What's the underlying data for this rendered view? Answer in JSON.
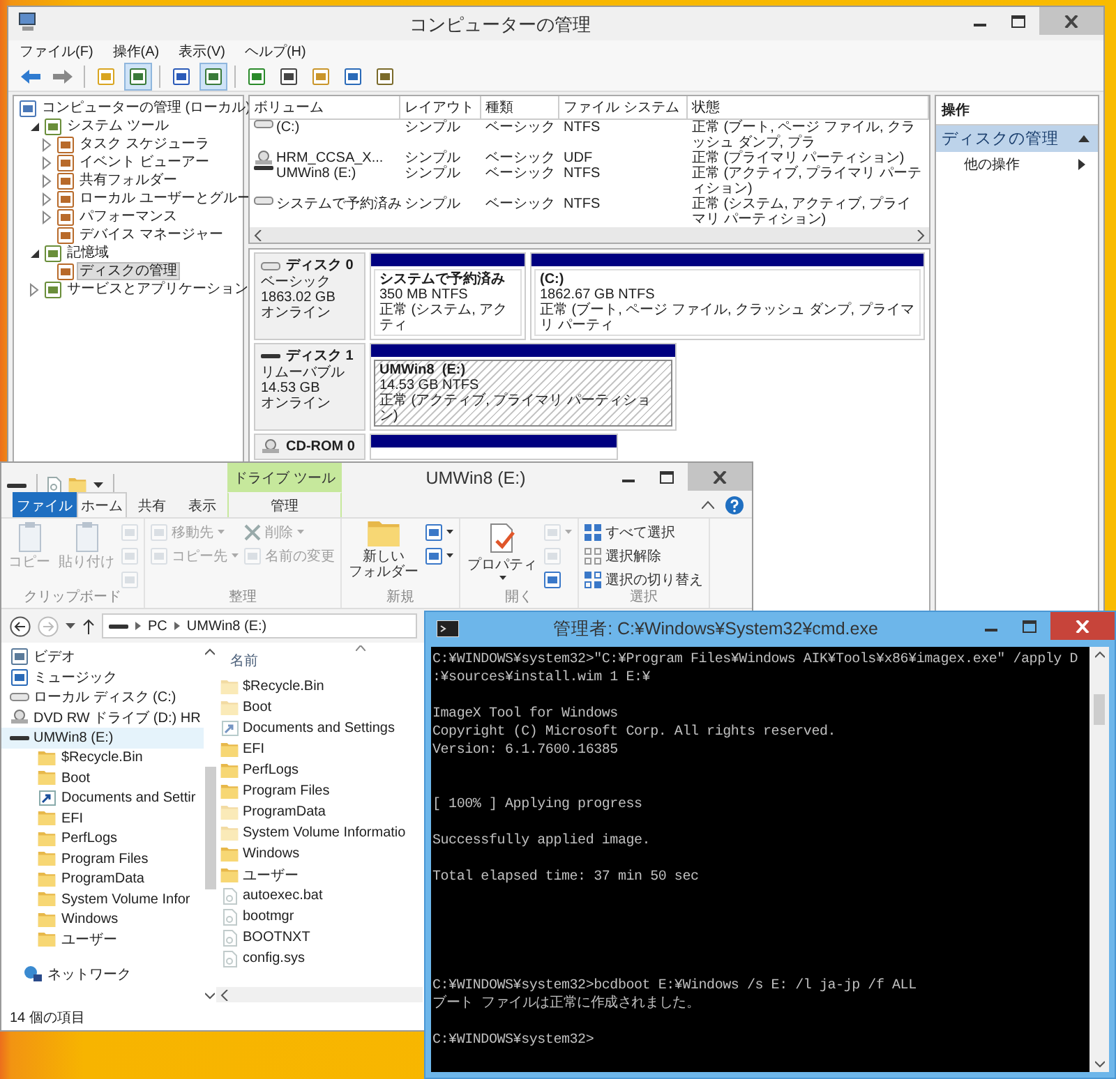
{
  "management": {
    "title": "コンピューターの管理",
    "menu": [
      "ファイル(F)",
      "操作(A)",
      "表示(V)",
      "ヘルプ(H)"
    ],
    "toolbar": {
      "tree_pane_on": true,
      "action_pane_on": true
    },
    "tree": [
      {
        "label": "コンピューターの管理 (ローカル)",
        "selected": false,
        "children": [
          {
            "label": "システム ツール",
            "expanded": true,
            "selected": false,
            "children": [
              {
                "label": "タスク スケジューラ",
                "expanded": false,
                "selected": false
              },
              {
                "label": "イベント ビューアー",
                "expanded": false,
                "selected": false
              },
              {
                "label": "共有フォルダー",
                "expanded": false,
                "selected": false
              },
              {
                "label": "ローカル ユーザーとグルー",
                "expanded": false,
                "selected": false
              },
              {
                "label": "パフォーマンス",
                "expanded": false,
                "selected": false
              },
              {
                "label": "デバイス マネージャー",
                "selected": false
              }
            ]
          },
          {
            "label": "記憶域",
            "expanded": true,
            "selected": false,
            "children": [
              {
                "label": "ディスクの管理",
                "selected": true
              }
            ]
          },
          {
            "label": "サービスとアプリケーション",
            "expanded": false,
            "selected": false
          }
        ]
      }
    ],
    "volumes": {
      "columns": [
        "ボリューム",
        "レイアウト",
        "種類",
        "ファイル システム",
        "状態"
      ],
      "rows": [
        {
          "kind": "fixed",
          "cells": [
            "(C:)",
            "シンプル",
            "ベーシック",
            "NTFS",
            "正常 (ブート, ページ ファイル, クラッシュ ダンプ, プラ"
          ]
        },
        {
          "kind": "cdrom",
          "cells": [
            "HRM_CCSA_X...",
            "シンプル",
            "ベーシック",
            "UDF",
            "正常 (プライマリ パーティション)"
          ]
        },
        {
          "kind": "removable",
          "cells": [
            "UMWin8 (E:)",
            "シンプル",
            "ベーシック",
            "NTFS",
            "正常 (アクティブ, プライマリ パーティション)"
          ]
        },
        {
          "kind": "fixed",
          "cells": [
            "システムで予約済み",
            "シンプル",
            "ベーシック",
            "NTFS",
            "正常 (システム, アクティブ, プライマリ パーティション)"
          ]
        }
      ]
    },
    "disks": [
      {
        "kind": "fixed",
        "name": "ディスク 0",
        "type": "ベーシック",
        "size": "1863.02 GB",
        "status": "オンライン",
        "partitions": [
          {
            "kind": "volume",
            "name": "システムで予約済み",
            "size": "350 MB NTFS",
            "status": "正常 (システム, アクティ",
            "selected": false
          },
          {
            "kind": "volume",
            "name": "(C:)",
            "size": "1862.67 GB NTFS",
            "status": "正常 (ブート, ページ ファイル, クラッシュ ダンプ, プライマリ パーティ",
            "selected": false
          }
        ]
      },
      {
        "kind": "removable",
        "name": "ディスク 1",
        "type": "リムーバブル",
        "size": "14.53 GB",
        "status": "オンライン",
        "partitions": [
          {
            "kind": "volume",
            "name": "UMWin8  (E:)",
            "size": "14.53 GB NTFS",
            "status": "正常 (アクティブ, プライマリ パーティション)",
            "selected": true
          }
        ]
      },
      {
        "kind": "cdrom",
        "name": "CD-ROM 0",
        "partitions": [
          {
            "kind": "bar"
          }
        ]
      }
    ],
    "actions": {
      "header": "操作",
      "section": "ディスクの管理",
      "items": [
        "他の操作"
      ]
    }
  },
  "explorer": {
    "title": "UMWin8 (E:)",
    "context_header": "ドライブ ツール",
    "tabs": [
      {
        "label": "ファイル",
        "kind": "file",
        "selected": false
      },
      {
        "label": "ホーム",
        "kind": "tab",
        "selected": true
      },
      {
        "label": "共有",
        "kind": "tab",
        "selected": false
      },
      {
        "label": "表示",
        "kind": "tab",
        "selected": false
      },
      {
        "label": "管理",
        "kind": "context",
        "selected": false
      }
    ],
    "ribbon": [
      {
        "label": "クリップボード",
        "columns": [
          [
            {
              "kind": "large",
              "label": "コピー",
              "disabled": true
            }
          ],
          [
            {
              "kind": "large",
              "label": "貼り付け",
              "disabled": true
            }
          ],
          [
            {
              "kind": "icon",
              "disabled": true
            },
            {
              "kind": "icon",
              "disabled": true
            },
            {
              "kind": "icon",
              "disabled": true
            }
          ]
        ]
      },
      {
        "label": "整理",
        "columns": [
          [
            {
              "kind": "small",
              "label": "移動先",
              "dropdown": true,
              "disabled": true
            },
            {
              "kind": "small",
              "label": "コピー先",
              "dropdown": true,
              "disabled": true
            }
          ],
          [
            {
              "kind": "small",
              "label": "削除",
              "dropdown": true,
              "disabled": true
            },
            {
              "kind": "small",
              "label": "名前の変更",
              "disabled": true
            }
          ]
        ]
      },
      {
        "label": "新規",
        "columns": [
          [
            {
              "kind": "large",
              "label": [
                "新しい",
                "フォルダー"
              ],
              "disabled": false
            }
          ],
          [
            {
              "kind": "icon",
              "dropdown": true,
              "disabled": false
            },
            {
              "kind": "icon",
              "dropdown": true,
              "disabled": false
            }
          ]
        ]
      },
      {
        "label": "開く",
        "columns": [
          [
            {
              "kind": "large",
              "label": "プロパティ",
              "dropdown": true,
              "disabled": false
            }
          ],
          [
            {
              "kind": "icon",
              "dropdown": true,
              "disabled": true
            },
            {
              "kind": "icon",
              "disabled": true
            },
            {
              "kind": "icon",
              "disabled": false
            }
          ]
        ]
      },
      {
        "label": "選択",
        "columns": [
          [
            {
              "kind": "small",
              "label": "すべて選択",
              "disabled": false
            },
            {
              "kind": "small",
              "label": "選択解除",
              "disabled": false
            },
            {
              "kind": "small",
              "label": "選択の切り替え",
              "disabled": false
            }
          ]
        ]
      }
    ],
    "address": [
      "PC",
      "UMWin8 (E:)"
    ],
    "nav": [
      {
        "label": "ビデオ",
        "kind": "video",
        "selected": false
      },
      {
        "label": "ミュージック",
        "kind": "music",
        "selected": false
      },
      {
        "label": "ローカル ディスク (C:)",
        "kind": "disk",
        "selected": false
      },
      {
        "label": "DVD RW ドライブ (D:) HR",
        "kind": "dvd",
        "selected": false
      },
      {
        "label": "UMWin8 (E:)",
        "kind": "drive",
        "selected": true,
        "children": [
          {
            "label": "$Recycle.Bin",
            "kind": "folder",
            "selected": false
          },
          {
            "label": "Boot",
            "kind": "folder",
            "selected": false
          },
          {
            "label": "Documents and Settir",
            "kind": "link",
            "selected": false
          },
          {
            "label": "EFI",
            "kind": "folder",
            "selected": false
          },
          {
            "label": "PerfLogs",
            "kind": "folder",
            "selected": false
          },
          {
            "label": "Program Files",
            "kind": "folder",
            "selected": false
          },
          {
            "label": "ProgramData",
            "kind": "folder",
            "selected": false
          },
          {
            "label": "System Volume Infor",
            "kind": "folder",
            "selected": false
          },
          {
            "label": "Windows",
            "kind": "folder",
            "selected": false
          },
          {
            "label": "ユーザー",
            "kind": "folder",
            "selected": false
          }
        ]
      }
    ],
    "network": {
      "label": "ネットワーク",
      "selected": false
    },
    "list_column": "名前",
    "files": [
      {
        "name": "$Recycle.Bin",
        "kind": "folder",
        "hidden": true
      },
      {
        "name": "Boot",
        "kind": "folder",
        "hidden": true
      },
      {
        "name": "Documents and Settings",
        "kind": "link",
        "hidden": true
      },
      {
        "name": "EFI",
        "kind": "folder",
        "hidden": false
      },
      {
        "name": "PerfLogs",
        "kind": "folder",
        "hidden": false
      },
      {
        "name": "Program Files",
        "kind": "folder",
        "hidden": false
      },
      {
        "name": "ProgramData",
        "kind": "folder",
        "hidden": true
      },
      {
        "name": "System Volume Informatio",
        "kind": "folder",
        "hidden": true
      },
      {
        "name": "Windows",
        "kind": "folder",
        "hidden": false
      },
      {
        "name": "ユーザー",
        "kind": "folder",
        "hidden": false
      },
      {
        "name": "autoexec.bat",
        "kind": "file",
        "hidden": true
      },
      {
        "name": "bootmgr",
        "kind": "file",
        "hidden": true
      },
      {
        "name": "BOOTNXT",
        "kind": "file",
        "hidden": true
      },
      {
        "name": "config.sys",
        "kind": "file",
        "hidden": true
      }
    ],
    "status": "14 個の項目"
  },
  "cmd": {
    "title": "管理者: C:¥Windows¥System32¥cmd.exe",
    "lines": [
      {
        "kind": "text",
        "text": "C:¥WINDOWS¥system32>\"C:¥Program Files¥Windows AIK¥Tools¥x86¥imagex.exe\" /apply D"
      },
      {
        "kind": "text",
        "text": ":¥sources¥install.wim 1 E:¥"
      },
      {
        "kind": "blank"
      },
      {
        "kind": "text",
        "text": "ImageX Tool for Windows"
      },
      {
        "kind": "text",
        "text": "Copyright (C) Microsoft Corp. All rights reserved."
      },
      {
        "kind": "text",
        "text": "Version: 6.1.7600.16385"
      },
      {
        "kind": "blank"
      },
      {
        "kind": "blank"
      },
      {
        "kind": "text",
        "text": "[ 100% ] Applying progress"
      },
      {
        "kind": "blank"
      },
      {
        "kind": "text",
        "text": "Successfully applied image."
      },
      {
        "kind": "blank"
      },
      {
        "kind": "text",
        "text": "Total elapsed time: 37 min 50 sec"
      },
      {
        "kind": "blank"
      },
      {
        "kind": "blank"
      },
      {
        "kind": "blank"
      },
      {
        "kind": "blank"
      },
      {
        "kind": "blank"
      },
      {
        "kind": "text",
        "text": "C:¥WINDOWS¥system32>bcdboot E:¥Windows /s E: /l ja-jp /f ALL"
      },
      {
        "kind": "text",
        "text": "ブート ファイルは正常に作成されました。"
      },
      {
        "kind": "blank"
      },
      {
        "kind": "text",
        "text": "C:¥WINDOWS¥system32>"
      }
    ]
  }
}
